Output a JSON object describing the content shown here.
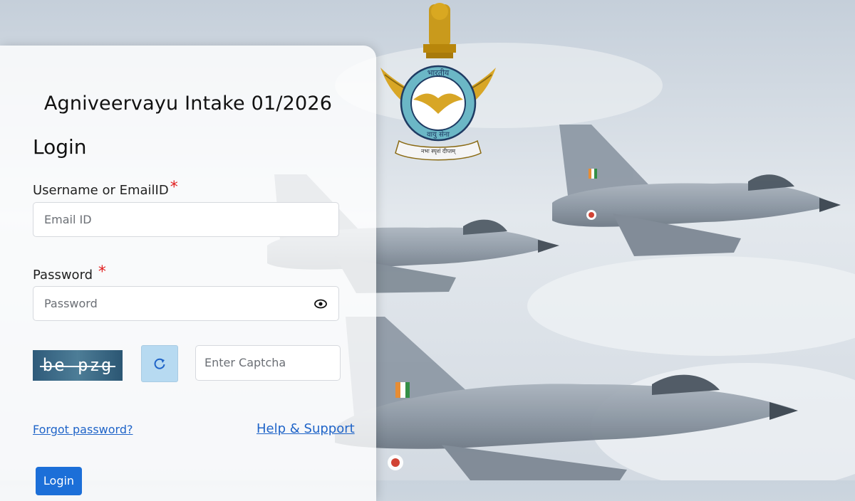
{
  "page": {
    "title": "Agniveervayu Intake 01/2026",
    "heading": "Login"
  },
  "form": {
    "username_label": "Username or EmailID",
    "username_placeholder": "Email ID",
    "password_label": "Password",
    "password_placeholder": "Password",
    "required_marker": "*",
    "captcha_text": "be pzg",
    "captcha_placeholder": "Enter Captcha",
    "forgot_password": "Forgot password?",
    "help_support": "Help & Support",
    "login_button": "Login"
  },
  "emblem": {
    "top_text": "भारतीय",
    "middle_text": "वायु सेना",
    "motto": "नभः स्पृशं दीप्तम्",
    "icon": "iaf-crest-icon"
  },
  "colors": {
    "accent": "#1c6fd8",
    "link": "#1f64c8",
    "required": "#e11d1d",
    "refresh_bg": "#b7daf1"
  }
}
